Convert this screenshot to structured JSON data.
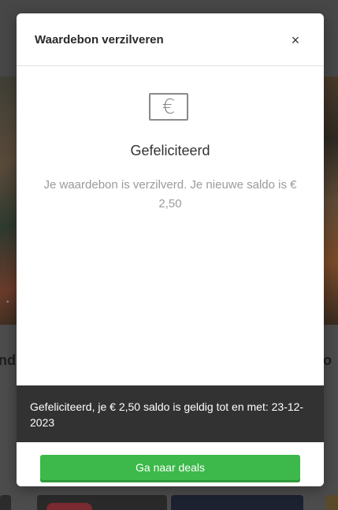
{
  "modal": {
    "title": "Waardebon verzilveren",
    "close_glyph": "×",
    "icon": "euro-voucher-icon",
    "icon_glyph": "€",
    "heading": "Gefeliciteerd",
    "message": "Je waardebon is verzilverd. Je nieuwe saldo is € 2,50"
  },
  "toast": {
    "text": "Gefeliciteerd, je € 2,50 saldo is geldig tot en met: 23-12-2023"
  },
  "footer": {
    "cta_label": "Ga naar deals"
  },
  "background": {
    "left_text": "nd",
    "right_text": "o"
  },
  "colors": {
    "accent_green": "#3cb94a",
    "toast_bg": "#323232",
    "overlay_bg": "#4c4c4c"
  }
}
